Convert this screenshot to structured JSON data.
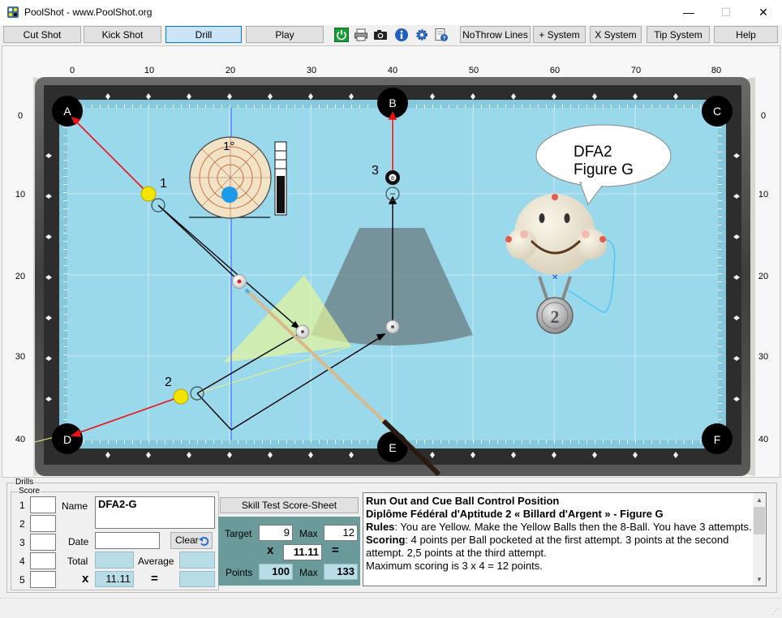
{
  "window": {
    "title": "PoolShot - www.PoolShot.org",
    "minimize_glyph": "—",
    "maximize_glyph": "☐",
    "close_glyph": "✕"
  },
  "toolbar": {
    "cut_shot": "Cut Shot",
    "kick_shot": "Kick Shot",
    "drill": "Drill",
    "play": "Play",
    "icons": [
      "power-icon",
      "print-icon",
      "camera-icon",
      "info-icon",
      "settings-icon",
      "help-document-icon"
    ],
    "no_throw_lines": "NoThrow Lines",
    "plus_system": "+ System",
    "x_system": "X System",
    "tip_system": "Tip System",
    "help": "Help"
  },
  "table": {
    "x_axis_labels": [
      "0",
      "10",
      "20",
      "30",
      "40",
      "50",
      "60",
      "70",
      "80"
    ],
    "y_axis_labels": [
      "0",
      "10",
      "20",
      "30",
      "40"
    ],
    "pockets": [
      "A",
      "B",
      "C",
      "D",
      "E",
      "F"
    ],
    "ball_numbers": [
      "1",
      "2",
      "3"
    ],
    "eight_ball_label": "8",
    "tip_degree_label": "1°",
    "speech_bubble": [
      "DFA2",
      "Figure G"
    ],
    "medal_number": "2",
    "colors": {
      "cloth": "#9ad8ec",
      "cushion": "#8fcfe2",
      "rail": "#505050",
      "object_ball": "#f5e300",
      "cue_ball": "#ffffff",
      "aim_line": "#ff0000",
      "path_line": "#000000"
    }
  },
  "drills": {
    "frame_label": "Drills",
    "score": {
      "frame_label": "Score",
      "rows": [
        "1",
        "2",
        "3",
        "4",
        "5"
      ],
      "name_label": "Name",
      "name_value": "DFA2-G",
      "date_label": "Date",
      "date_value": "",
      "clear_button": "Clear",
      "total_label": "Total",
      "average_label": "Average",
      "x_symbol": "x",
      "multiplier": "11.11",
      "equals_symbol": "="
    },
    "skill_test_button": "Skill Test Score-Sheet",
    "calc": {
      "target_label": "Target",
      "target_value": "9",
      "max_label": "Max",
      "max_value": "12",
      "x_symbol": "x",
      "multiplier": "11.11",
      "equals_symbol": "=",
      "points_label": "Points",
      "points_value": "100",
      "points_max_label": "Max",
      "points_max_value": "133"
    },
    "description": {
      "line1": "Run Out and Cue Ball Control Position",
      "line2": "Diplôme Fédéral d'Aptitude 2 « Billard d'Argent » - Figure G",
      "rules_label": "Rules",
      "rules_text": ": You are Yellow. Make the Yellow Balls then the 8-Ball. You have 3 attempts.",
      "scoring_label": "Scoring",
      "scoring_text": ": 4 points per Ball pocketed at the first attempt. 3 points at the second attempt. 2,5 points at the third attempt.",
      "max_text": "Maximum scoring is 3 x 4 = 12 points."
    }
  }
}
